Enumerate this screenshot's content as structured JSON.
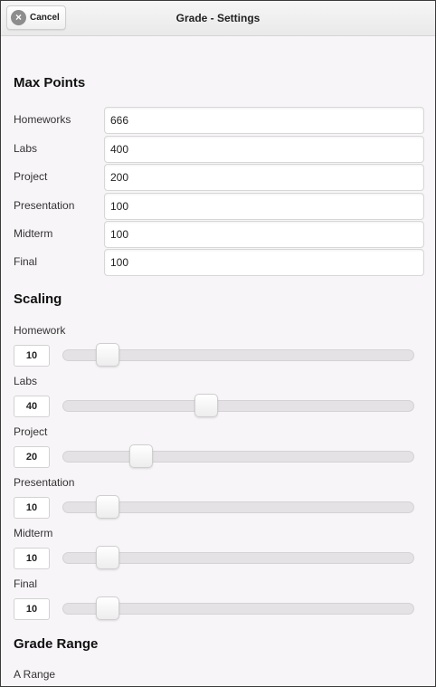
{
  "header": {
    "cancel_label": "Cancel",
    "title": "Grade - Settings"
  },
  "max_points": {
    "title": "Max Points",
    "fields": [
      {
        "label": "Homeworks",
        "value": "666"
      },
      {
        "label": "Labs",
        "value": "400"
      },
      {
        "label": "Project",
        "value": "200"
      },
      {
        "label": "Presentation",
        "value": "100"
      },
      {
        "label": "Midterm",
        "value": "100"
      },
      {
        "label": "Final",
        "value": "100"
      }
    ]
  },
  "scaling": {
    "title": "Scaling",
    "sliders": [
      {
        "label": "Homework",
        "value": "10",
        "fraction": 0.1
      },
      {
        "label": "Labs",
        "value": "40",
        "fraction": 0.4
      },
      {
        "label": "Project",
        "value": "20",
        "fraction": 0.2
      },
      {
        "label": "Presentation",
        "value": "10",
        "fraction": 0.1
      },
      {
        "label": "Midterm",
        "value": "10",
        "fraction": 0.1
      },
      {
        "label": "Final",
        "value": "10",
        "fraction": 0.1
      }
    ]
  },
  "grade_range": {
    "title": "Grade Range",
    "first_label": "A Range"
  }
}
